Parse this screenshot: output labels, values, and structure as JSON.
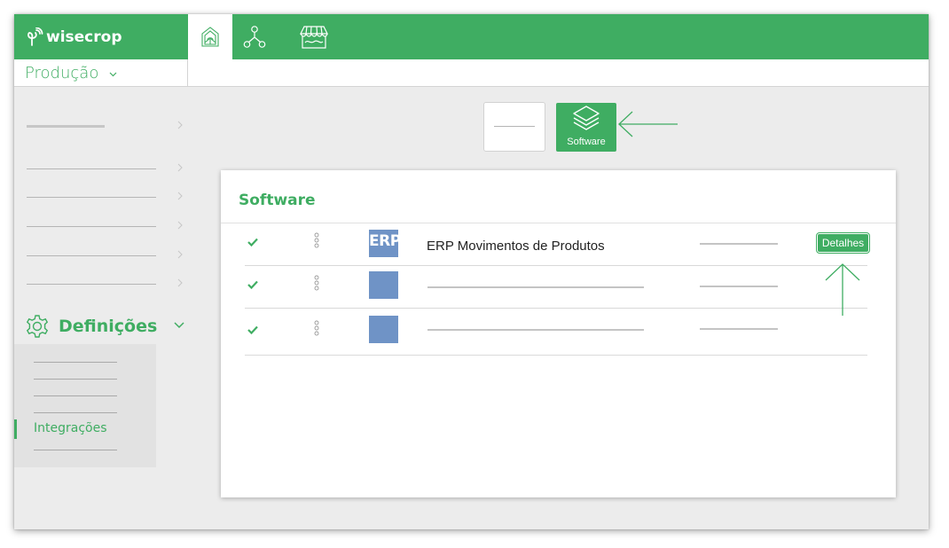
{
  "app": {
    "brand": "wisecrop",
    "module_label": "Produção"
  },
  "topbar_tabs": [
    {
      "icon": "greenhouse-icon",
      "active": true
    },
    {
      "icon": "network-icon",
      "active": false
    },
    {
      "icon": "market-stall-icon",
      "active": false
    }
  ],
  "sidebar": {
    "settings_label": "Definições",
    "settings_icon": "gear-icon",
    "submenu_active_label": "Integrações"
  },
  "categories": {
    "software_label": "Software",
    "software_icon": "layers-icon"
  },
  "card": {
    "title": "Software",
    "rows": [
      {
        "logo_text": "ERP",
        "name": "ERP Movimentos de Produtos",
        "action_label": "Detalhes"
      },
      {
        "logo_text": "",
        "name": ""
      },
      {
        "logo_text": "",
        "name": ""
      }
    ]
  },
  "colors": {
    "brand_green": "#3fad62",
    "logo_blue": "#6f93c6",
    "background": "#ececec"
  }
}
